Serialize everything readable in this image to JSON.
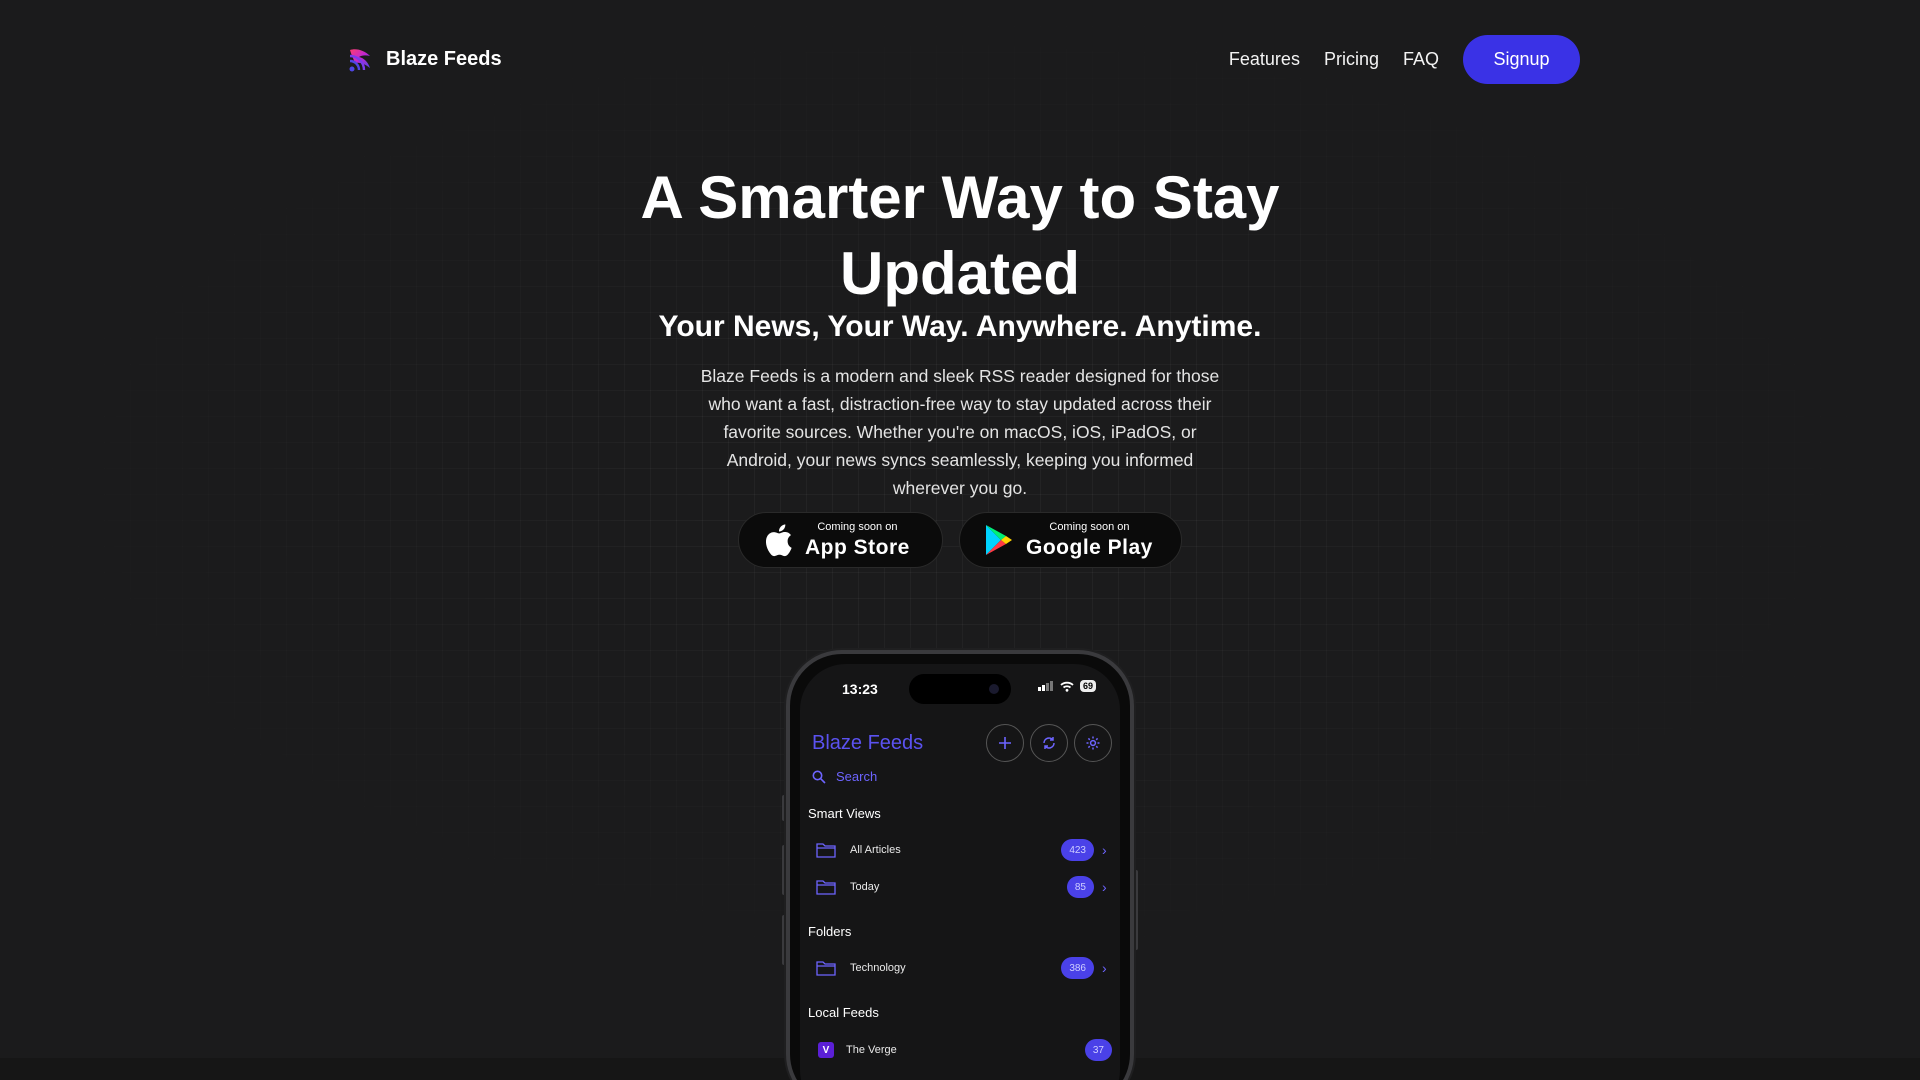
{
  "brand": {
    "name": "Blaze Feeds"
  },
  "nav": {
    "links": [
      "Features",
      "Pricing",
      "FAQ"
    ],
    "signup": "Signup"
  },
  "hero": {
    "title": "A Smarter Way to Stay Updated",
    "subtitle": "Your News, Your Way. Anywhere. Anytime.",
    "description": "Blaze Feeds is a modern and sleek RSS reader designed for those who want a fast, distraction-free way to stay updated across their favorite sources. Whether you're on macOS, iOS, iPadOS, or Android, your news syncs seamlessly, keeping you informed wherever you go."
  },
  "stores": {
    "apple": {
      "small": "Coming soon on",
      "big": "App Store",
      "icon": "apple-icon"
    },
    "google": {
      "small": "Coming soon on",
      "big": "Google Play",
      "icon": "google-play-icon"
    }
  },
  "phone": {
    "time": "13:23",
    "battery": "69",
    "app_title": "Blaze Feeds",
    "search_placeholder": "Search",
    "smart_views": {
      "heading": "Smart Views",
      "items": [
        {
          "label": "All Articles",
          "count": "423"
        },
        {
          "label": "Today",
          "count": "85"
        }
      ]
    },
    "folders": {
      "heading": "Folders",
      "items": [
        {
          "label": "Technology",
          "count": "386"
        }
      ]
    },
    "local_feeds": {
      "heading": "Local Feeds",
      "items": [
        {
          "label": "The Verge",
          "count": "37",
          "logo": "V"
        }
      ]
    }
  },
  "colors": {
    "accent": "#3a32e6",
    "accent_light": "#5b52f0",
    "background": "#1b1b1c"
  }
}
